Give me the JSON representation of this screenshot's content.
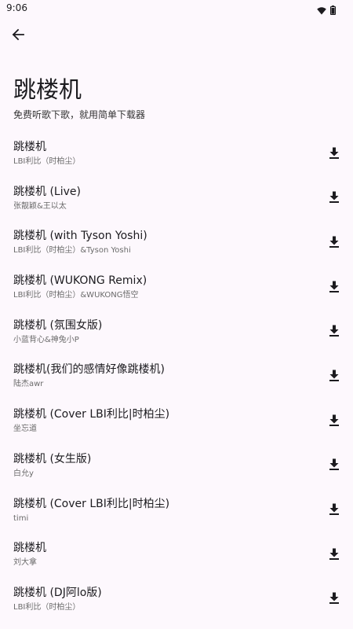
{
  "status_bar": {
    "time": "9:06",
    "icons": [
      "wifi-icon",
      "battery-icon"
    ]
  },
  "header": {
    "back_icon": "arrow-left-icon",
    "title": "跳楼机",
    "subtitle": "免费听歌下歌，就用简单下载器"
  },
  "songs": [
    {
      "title": "跳楼机",
      "artist": "LBI利比（时柏尘）"
    },
    {
      "title": "跳楼机 (Live)",
      "artist": "张靓颖&王以太"
    },
    {
      "title": "跳楼机 (with Tyson Yoshi)",
      "artist": "LBI利比（时柏尘）&Tyson Yoshi"
    },
    {
      "title": "跳楼机 (WUKONG Remix)",
      "artist": "LBI利比（时柏尘）&WUKONG悟空"
    },
    {
      "title": "跳楼机 (氛围女版)",
      "artist": "小蓝背心&神兔小P"
    },
    {
      "title": "跳楼机(我们的感情好像跳楼机)",
      "artist": "陆杰awr"
    },
    {
      "title": "跳楼机 (Cover LBI利比|时柏尘)",
      "artist": "坐忘道"
    },
    {
      "title": "跳楼机 (女生版)",
      "artist": "白允y"
    },
    {
      "title": "跳楼机 (Cover LBI利比|时柏尘)",
      "artist": "timi"
    },
    {
      "title": "跳楼机",
      "artist": "刘大拿"
    },
    {
      "title": "跳楼机 (DJ阿lo版)",
      "artist": "LBI利比（时柏尘）"
    }
  ],
  "download_icon": "download-icon"
}
